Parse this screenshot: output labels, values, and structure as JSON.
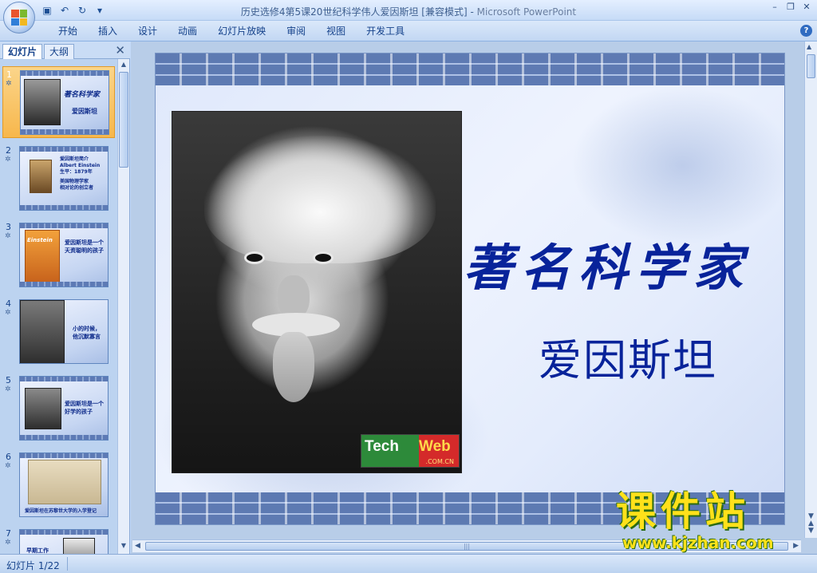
{
  "window": {
    "title_doc": "历史选修4第5课20世纪科学伟人爱因斯坦 [兼容模式]",
    "title_sep": " - ",
    "title_app": "Microsoft PowerPoint"
  },
  "qat": {
    "save_icon": "save-icon",
    "undo_icon": "undo-icon",
    "redo_icon": "redo-icon",
    "undo_glyph": "↶",
    "redo_glyph": "↻",
    "dropdown_glyph": "▾",
    "save_glyph": "▣"
  },
  "window_controls": {
    "minimize": "–",
    "restore": "❐",
    "close": "✕"
  },
  "ribbon": {
    "tabs": [
      "开始",
      "插入",
      "设计",
      "动画",
      "幻灯片放映",
      "审阅",
      "视图",
      "开发工具"
    ],
    "help_label": "?"
  },
  "left_pane": {
    "tabs": {
      "slides": "幻灯片",
      "outline": "大纲"
    },
    "close_glyph": "✕",
    "star_glyph": "✲",
    "thumbs": [
      {
        "num": "1",
        "lines": [
          "著名科学家",
          "爱因斯坦"
        ]
      },
      {
        "num": "2",
        "lines": [
          "爱因斯坦简介",
          "Albert Einstein",
          "生平：1879年",
          "美国物理学家",
          "相对论的创立者"
        ]
      },
      {
        "num": "3",
        "lines": [
          "爱因斯坦是一个",
          "天资聪明的孩子"
        ],
        "badge": "Einstein"
      },
      {
        "num": "4",
        "lines": [
          "小的时候，",
          "他沉默寡言"
        ]
      },
      {
        "num": "5",
        "lines": [
          "爱因斯坦是一个",
          "好学的孩子"
        ]
      },
      {
        "num": "6",
        "lines": [
          "爱因斯坦在苏黎世大学的入学登记"
        ]
      },
      {
        "num": "7",
        "lines": [
          "早期工作"
        ]
      }
    ]
  },
  "slide": {
    "headline": "著名科学家",
    "name": "爱因斯坦",
    "photo_logo": {
      "part1": "Tech",
      "part2": "Web",
      "sub": ".COM.CN"
    }
  },
  "watermark": {
    "cn": "课件站",
    "url": "www.kjzhan.com"
  },
  "status": {
    "slide_info": "幻灯片 1/22"
  },
  "colors": {
    "accent": "#15428b",
    "title_text": "#08239a",
    "selected_thumb": "#f7b74c"
  }
}
